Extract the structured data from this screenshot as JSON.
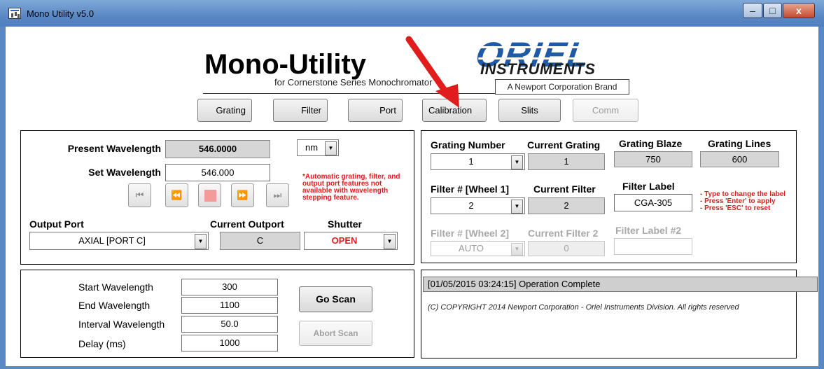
{
  "window": {
    "title": "Mono Utility v5.0",
    "minimize_glyph": "–",
    "maximize_glyph": "□",
    "close_glyph": "x"
  },
  "header": {
    "title": "Mono-Utility",
    "subtitle": "for Cornerstone Series Monochromator",
    "logo_text": "ORIEL",
    "logo_subtext": "INSTRUMENTS",
    "brand_tagline": "A Newport Corporation Brand"
  },
  "nav": {
    "grating": "Grating",
    "filter": "Filter",
    "port": "Port",
    "calibration": "Calibration",
    "slits": "Slits",
    "comm": "Comm"
  },
  "wavelength": {
    "present_label": "Present Wavelength",
    "present_value": "546.0000",
    "units": "nm",
    "set_label": "Set Wavelength",
    "set_value": "546.000",
    "stepping_note": "*Automatic grating, filter, and output port features not available with wavelength stepping feature.",
    "output_port_label": "Output Port",
    "output_port_value": "AXIAL [PORT C]",
    "current_outport_label": "Current Outport",
    "current_outport_value": "C",
    "shutter_label": "Shutter",
    "shutter_value": "OPEN",
    "step_buttons": [
      "⏮",
      "⏪",
      "⏹",
      "⏩",
      "⏭"
    ]
  },
  "grating": {
    "number_label": "Grating Number",
    "number_value": "1",
    "current_label": "Current Grating",
    "current_value": "1",
    "blaze_label": "Grating Blaze",
    "blaze_value": "750",
    "lines_label": "Grating Lines",
    "lines_value": "600"
  },
  "filter": {
    "wheel1_label": "Filter # [Wheel 1]",
    "wheel1_value": "2",
    "current_label": "Current Filter",
    "current_value": "2",
    "label_label": "Filter Label",
    "label_value": "CGA-305",
    "hints": [
      "- Type to change the label",
      "- Press 'Enter' to apply",
      "- Press 'ESC' to reset"
    ],
    "wheel2_label": "Filter # [Wheel 2]",
    "wheel2_value": "AUTO",
    "current2_label": "Current Filter 2",
    "current2_value": "0",
    "label2_label": "Filter Label #2",
    "label2_value": ""
  },
  "scan": {
    "start_label": "Start Wavelength",
    "start_value": "300",
    "end_label": "End Wavelength",
    "end_value": "1100",
    "interval_label": "Interval Wavelength",
    "interval_value": "50.0",
    "delay_label": "Delay (ms)",
    "delay_value": "1000",
    "go_label": "Go Scan",
    "abort_label": "Abort Scan"
  },
  "status": {
    "message": "[01/05/2015  03:24:15]  Operation Complete",
    "copyright": "(C) COPYRIGHT 2014   Newport Corporation - Oriel Instruments Division. All rights reserved"
  },
  "colors": {
    "accent_red": "#e01c1c",
    "title_blue": "#5a88c4",
    "oriel_blue": "#1e5aa8"
  }
}
